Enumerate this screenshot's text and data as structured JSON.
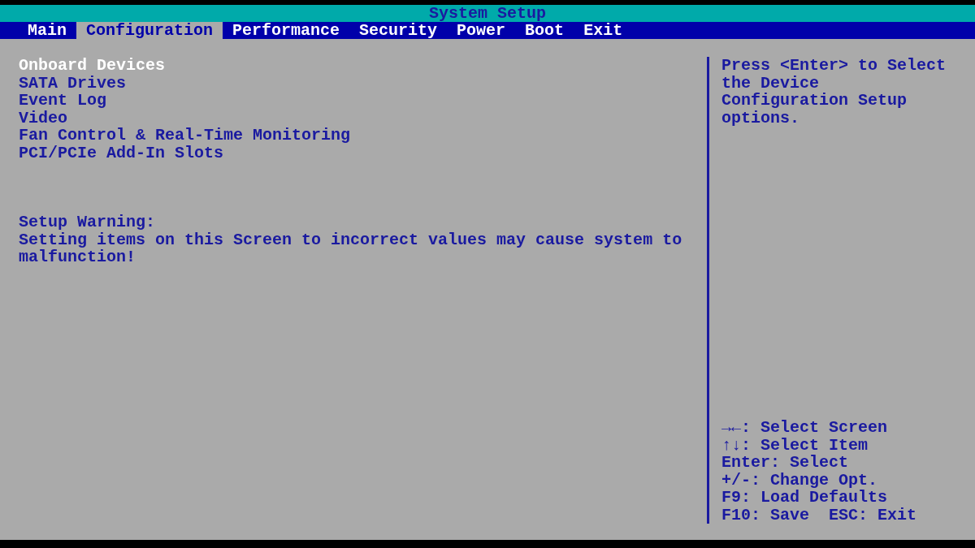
{
  "window": {
    "title": "System Setup"
  },
  "tabs": [
    {
      "label": "Main",
      "selected": false
    },
    {
      "label": "Configuration",
      "selected": true
    },
    {
      "label": "Performance",
      "selected": false
    },
    {
      "label": "Security",
      "selected": false
    },
    {
      "label": "Power",
      "selected": false
    },
    {
      "label": "Boot",
      "selected": false
    },
    {
      "label": "Exit",
      "selected": false
    }
  ],
  "menu": [
    {
      "label": "Onboard Devices",
      "selected": true
    },
    {
      "label": "SATA Drives",
      "selected": false
    },
    {
      "label": "Event Log",
      "selected": false
    },
    {
      "label": "Video",
      "selected": false
    },
    {
      "label": "Fan Control & Real-Time Monitoring",
      "selected": false
    },
    {
      "label": "PCI/PCIe Add-In Slots",
      "selected": false
    }
  ],
  "warning": {
    "title": "Setup Warning:",
    "text": "Setting items on this Screen to incorrect values may cause system to malfunction!"
  },
  "help": [
    "Press <Enter> to Select",
    "the Device",
    "Configuration Setup",
    "options."
  ],
  "keys": [
    "→←: Select Screen",
    "↑↓: Select Item",
    "Enter: Select",
    "+/-: Change Opt.",
    "F9: Load Defaults",
    "F10: Save  ESC: Exit"
  ]
}
